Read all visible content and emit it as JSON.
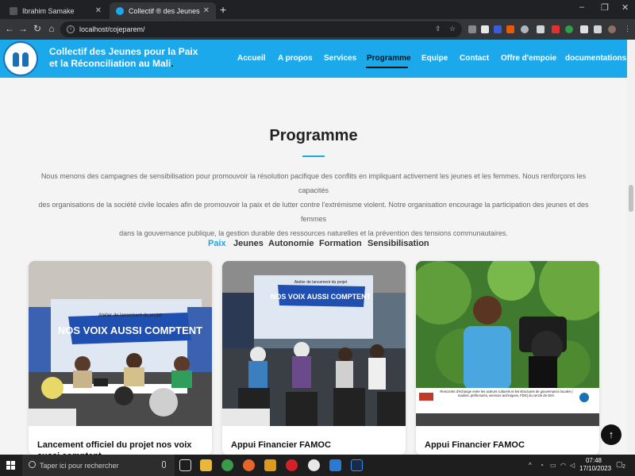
{
  "browser": {
    "tabs": [
      {
        "title": "Ibrahim Samake",
        "active": false
      },
      {
        "title": "Collectif ® des Jeunes pour la Paix",
        "active": true
      }
    ],
    "url": "localhost/cojeparem/",
    "new_tab": "+",
    "window_controls": [
      "–",
      "❐",
      "✕"
    ],
    "nav_icons": [
      "←",
      "→",
      "↻",
      "⌂"
    ]
  },
  "site": {
    "brand_line1": "Collectif des Jeunes pour la Paix",
    "brand_line2": "et la Réconciliation au Mali",
    "brand_dot": ".",
    "nav": [
      "Accueil",
      "A propos",
      "Services",
      "Programme",
      "Equipe",
      "Contact",
      "Offre d'empoie",
      "documentations"
    ],
    "active_nav": "Programme",
    "accent_color": "#1ba9ec"
  },
  "section": {
    "title": "Programme",
    "intro_line1": "Nous menons des campagnes de sensibilisation pour promouvoir la résolution pacifique des conflits en impliquant activement les jeunes et les femmes. Nous renforçons les capacités",
    "intro_line2": "des organisations de la société civile locales afin de promouvoir la paix et de lutter contre l'extrémisme violent. Notre organisation encourage la participation des jeunes et des femmes",
    "intro_line3": "dans la gouvernance publique, la gestion durable des ressources naturelles et la prévention des tensions communautaires.",
    "filters": [
      "Paix",
      "Jeunes",
      "Autonomie",
      "Formation",
      "Sensibilisation"
    ],
    "active_filter": "Paix"
  },
  "cards": [
    {
      "title": "Lancement officiel du projet nos voix aussi comptent",
      "banner": "NOS VOIX AUSSI COMPTENT",
      "banner_top": "Atelier de lancement du projet"
    },
    {
      "title": "Appui Financier FAMOC",
      "banner": "NOS VOIX AUSSI COMPTENT",
      "banner_top": "Atelier de lancement du projet"
    },
    {
      "title": "Appui Financier FAMOC",
      "caption": "Rencontre d'échange entre les acteurs culturels et les structures de gouvernance locales ( mairies, préfectures, services techniques, FDS) du cercle de Diré."
    }
  ],
  "scroll_top_icon": "↑",
  "taskbar": {
    "search_placeholder": "Taper ici pour rechercher",
    "time": "07:48",
    "date": "17/10/2023",
    "notifications": "2"
  }
}
